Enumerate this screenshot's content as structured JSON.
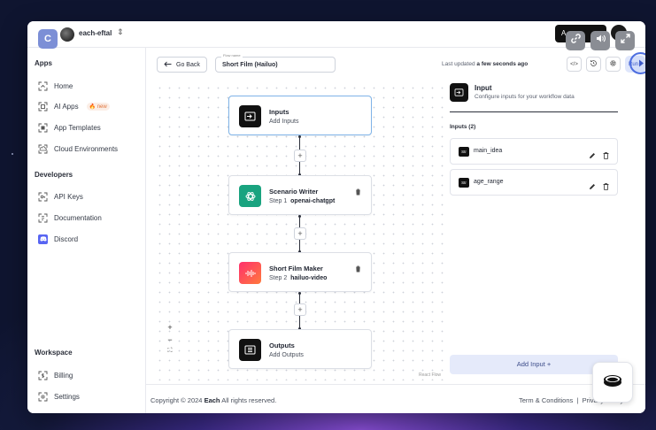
{
  "workspace": {
    "name": "each-eftal"
  },
  "topbar": {
    "dark_button_label": "A"
  },
  "sidebar": {
    "sections": {
      "apps": "Apps",
      "developers": "Developers",
      "workspace": "Workspace"
    },
    "items": {
      "home": "Home",
      "ai_apps": "AI Apps",
      "ai_apps_badge": "new",
      "app_templates": "App Templates",
      "cloud_environments": "Cloud Environments",
      "api_keys": "API Keys",
      "documentation": "Documentation",
      "discord": "Discord",
      "billing": "Billing",
      "settings": "Settings"
    }
  },
  "toolbar": {
    "go_back": "Go Back",
    "flow_name_label": "Flow name",
    "flow_name_value": "Short Film (Hailuo)",
    "last_updated_prefix": "Last updated",
    "last_updated_value": "a few seconds ago",
    "code_icon_label": "</>",
    "run_label": "Run"
  },
  "flow": {
    "nodes": [
      {
        "title": "Inputs",
        "subtitle": "Add Inputs"
      },
      {
        "title": "Scenario Writer",
        "step": "Step 1",
        "service": "openai-chatgpt"
      },
      {
        "title": "Short Film Maker",
        "step": "Step 2",
        "service": "hailuo-video"
      },
      {
        "title": "Outputs",
        "subtitle": "Add Outputs"
      }
    ],
    "plus_label": "+",
    "zoom_in": "+",
    "zoom_out": "−",
    "fit": "⛶",
    "attribution": "React Flow"
  },
  "panel": {
    "title": "Input",
    "subtitle": "Configure inputs for your workflow data",
    "inputs_heading": "Inputs (2)",
    "type_tag": "Str",
    "inputs": [
      "main_idea",
      "age_range"
    ],
    "add_input": "Add Input +"
  },
  "footer": {
    "copyright_prefix": "Copyright © 2024",
    "brand": "Each",
    "copyright_suffix": "All rights reserved.",
    "terms": "Term & Conditions",
    "separator": "|",
    "privacy": "Privacy Policy"
  },
  "overlay": {
    "c_button": "C"
  },
  "colors": {
    "accent": "#4d6ee0",
    "selected_border": "#7fb3e8",
    "openai_green": "#19a37f",
    "hailuo_gradient_start": "#ff2f6d",
    "hailuo_gradient_end": "#ff7a3c"
  }
}
